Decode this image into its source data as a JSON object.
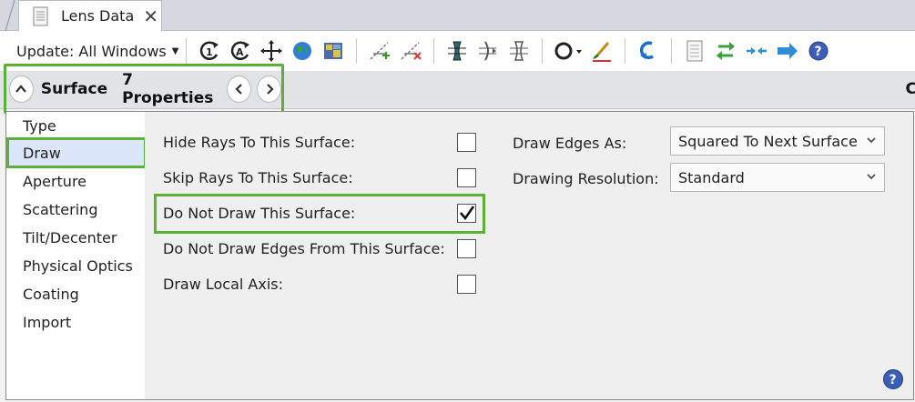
{
  "tab": {
    "title": "Lens Data",
    "close_glyph": "✕"
  },
  "toolbar": {
    "update_label": "Update: All Windows",
    "icons": [
      "rotate-c-icon",
      "rotate-a-icon",
      "crosshair-move-icon",
      "globe-icon",
      "map-icon",
      "ray-add-icon",
      "ray-remove-icon",
      "lens-element-icon",
      "lens-half-icon",
      "lens-outline-icon",
      "ring-icon",
      "paint-brush-icon",
      "undo-arrow-icon",
      "document-icon",
      "swap-arrows-icon",
      "collapse-arrows-icon",
      "right-arrow-icon",
      "help-icon"
    ]
  },
  "propbar": {
    "section": "Surface",
    "count_label": "7 Properties",
    "right_letter": "C"
  },
  "sidebar": {
    "items": [
      "Type",
      "Draw",
      "Aperture",
      "Scattering",
      "Tilt/Decenter",
      "Physical Optics",
      "Coating",
      "Import"
    ],
    "selected": "Draw"
  },
  "options": [
    {
      "label": "Hide Rays To This Surface:",
      "checked": false
    },
    {
      "label": "Skip Rays To This Surface:",
      "checked": false
    },
    {
      "label": "Do Not Draw This Surface:",
      "checked": true
    },
    {
      "label": "Do Not Draw Edges From This Surface:",
      "checked": false
    },
    {
      "label": "Draw Local Axis:",
      "checked": false
    }
  ],
  "draw_edges": {
    "label": "Draw Edges As:",
    "value": "Squared To Next Surface"
  },
  "draw_resolution": {
    "label": "Drawing Resolution:",
    "value": "Standard"
  },
  "colors": {
    "highlight": "#5ab133",
    "selected_bg": "#dbe6fa",
    "panel_bg": "#efefef",
    "help_blue": "#3b5fb8"
  }
}
